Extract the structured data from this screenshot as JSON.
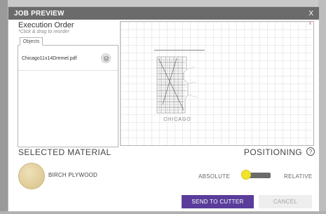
{
  "dialog": {
    "title": "JOB PREVIEW",
    "close_label": "X"
  },
  "execution": {
    "title": "Execution Order",
    "hint": "*Click & drag to reorder",
    "tab_label": "Objects",
    "items": [
      {
        "name": "Chicago11x14Dremel.pdf",
        "icon": "layers-icon"
      }
    ]
  },
  "preview": {
    "corner_mark": "x",
    "thumbnail_caption": "CHICAGO"
  },
  "material": {
    "heading": "SELECTED MATERIAL",
    "name": "BIRCH PLYWOOD",
    "swatch_color": "#e2cf9d"
  },
  "positioning": {
    "heading": "POSITIONING",
    "help_icon": "?",
    "absolute_label": "ABSOLUTE",
    "relative_label": "RELATIVE",
    "selected": "ABSOLUTE"
  },
  "actions": {
    "send_label": "SEND TO CUTTER",
    "cancel_label": "CANCEL"
  },
  "colors": {
    "titlebar": "#6b6b6b",
    "send_button": "#5a3d9a",
    "toggle_knob": "#f3e42b"
  }
}
